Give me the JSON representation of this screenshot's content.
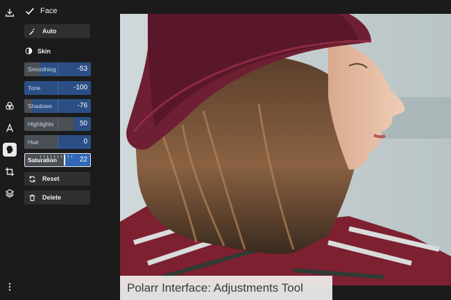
{
  "rail": {
    "icons": [
      "download-icon",
      "circles-icon",
      "text-icon",
      "face-icon",
      "crop-icon",
      "layers-icon",
      "more-icon"
    ]
  },
  "panel": {
    "title": "Face",
    "auto_label": "Auto",
    "section_label": "Skin",
    "sliders": [
      {
        "label": "Smoothing",
        "value": "-53",
        "level": -53
      },
      {
        "label": "Tone",
        "value": "-100",
        "level": -100
      },
      {
        "label": "Shadows",
        "value": "-76",
        "level": -76
      },
      {
        "label": "Highlights",
        "value": "50",
        "level": 50
      },
      {
        "label": "Hue",
        "value": "0",
        "level": 0
      },
      {
        "label": "Saturation",
        "value": "22",
        "level": 22
      }
    ],
    "reset_label": "Reset",
    "delete_label": "Delete"
  },
  "caption": "Polarr Interface: Adjustments Tool",
  "colors": {
    "background": "#1b1b1b",
    "slider_blue": "#2b4f84",
    "active_blue": "#3168b6",
    "button": "#2f2f2f"
  }
}
